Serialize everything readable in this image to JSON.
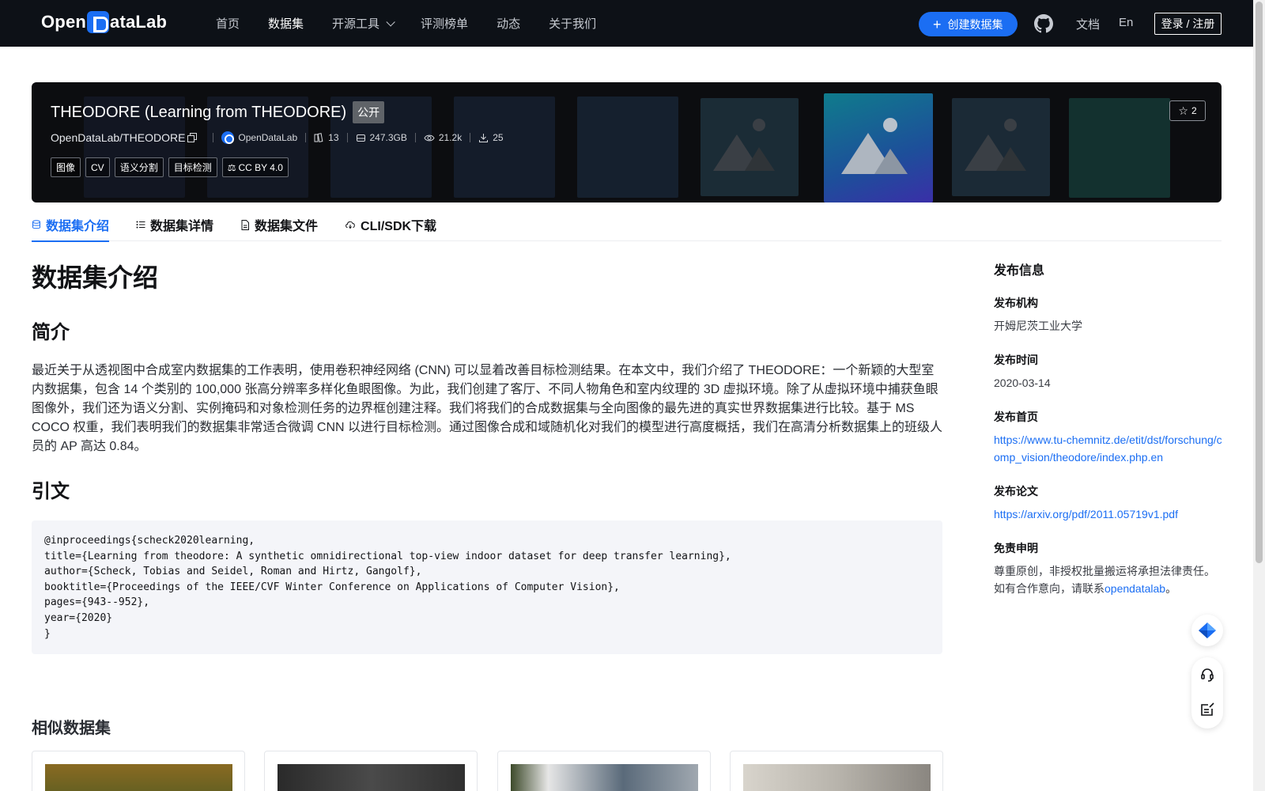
{
  "nav": {
    "logo_text_1": "Open",
    "logo_text_2": "ataLab",
    "links": [
      "首页",
      "数据集",
      "开源工具",
      "评测榜单",
      "动态",
      "关于我们"
    ],
    "create_label": "创建数据集",
    "docs": "文档",
    "lang": "En",
    "login": "登录 / 注册"
  },
  "banner": {
    "title": "THEODORE (Learning from THEODORE)",
    "visibility": "公开",
    "repo": "OpenDataLab/THEODORE",
    "org": "OpenDataLab",
    "files": "13",
    "size": "247.3GB",
    "views": "21.2k",
    "downloads": "25",
    "tags": [
      "图像",
      "CV",
      "语义分割",
      "目标检测",
      "CC BY 4.0"
    ],
    "stars": "2"
  },
  "tabs": [
    "数据集介绍",
    "数据集详情",
    "数据集文件",
    "CLI/SDK下载"
  ],
  "content": {
    "heading": "数据集介绍",
    "intro_heading": "简介",
    "intro_text": "最近关于从透视图中合成室内数据集的工作表明，使用卷积神经网络 (CNN) 可以显着改善目标检测结果。在本文中，我们介绍了 THEODORE：一个新颖的大型室内数据集，包含 14 个类别的 100,000 张高分辨率多样化鱼眼图像。为此，我们创建了客厅、不同人物角色和室内纹理的 3D 虚拟环境。除了从虚拟环境中捕获鱼眼图像外，我们还为语义分割、实例掩码和对象检测任务的边界框创建注释。我们将我们的合成数据集与全向图像的最先进的真实世界数据集进行比较。基于 MS COCO 权重，我们表明我们的数据集非常适合微调 CNN 以进行目标检测。通过图像合成和域随机化对我们的模型进行高度概括，我们在高清分析数据集上的班级人员的 AP 高达 0.84。",
    "citation_heading": "引文",
    "citation": "@inproceedings{scheck2020learning,\ntitle={Learning from theodore: A synthetic omnidirectional top-view indoor dataset for deep transfer learning},\nauthor={Scheck, Tobias and Seidel, Roman and Hirtz, Gangolf},\nbooktitle={Proceedings of the IEEE/CVF Winter Conference on Applications of Computer Vision},\npages={943--952},\nyear={2020}\n}",
    "similar_heading": "相似数据集"
  },
  "sidebar": {
    "title": "发布信息",
    "org_label": "发布机构",
    "org_value": "开姆尼茨工业大学",
    "date_label": "发布时间",
    "date_value": "2020-03-14",
    "home_label": "发布首页",
    "home_url": "https://www.tu-chemnitz.de/etit/dst/forschung/comp_vision/theodore/index.php.en",
    "paper_label": "发布论文",
    "paper_url": "https://arxiv.org/pdf/2011.05719v1.pdf",
    "disclaimer_label": "免责申明",
    "disclaimer_text": "尊重原创，非授权批量搬运将承担法律责任。如有合作意向，请联系",
    "disclaimer_link": "opendatalab",
    "disclaimer_end": "。"
  },
  "colors": {
    "accent": "#1b6ef3",
    "nav_bg": "#0d1117"
  }
}
